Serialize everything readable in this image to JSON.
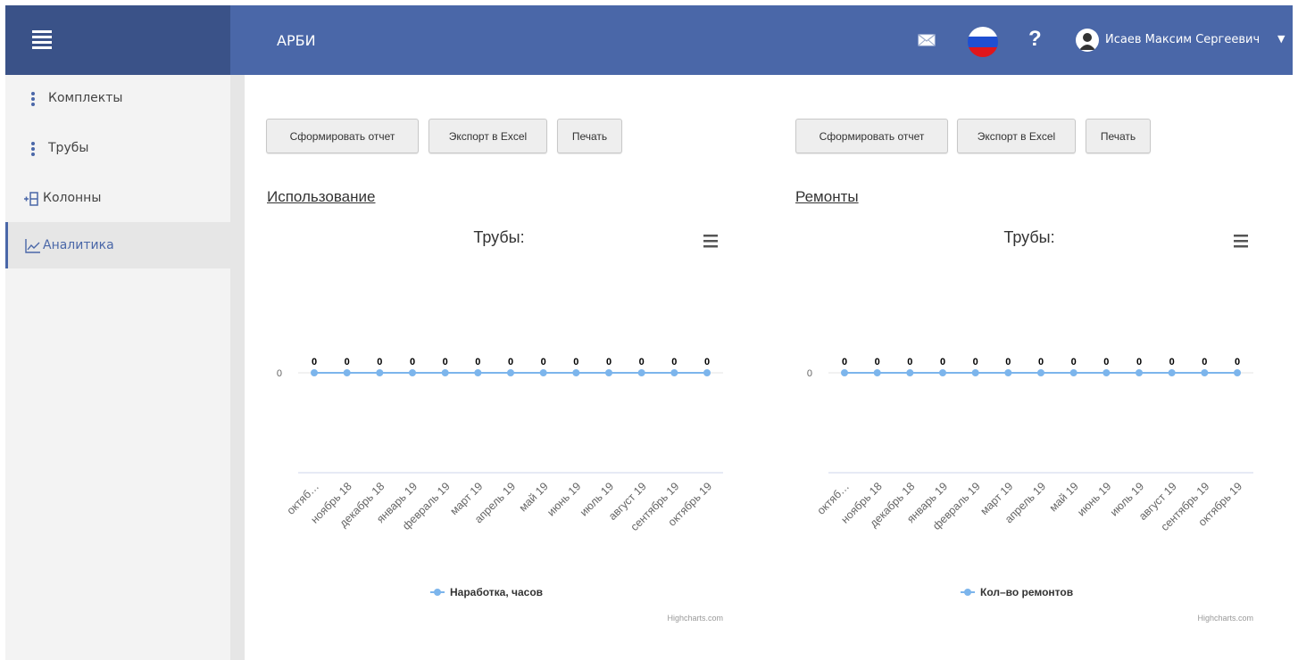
{
  "header": {
    "app_title": "АРБИ",
    "user_name": "Исаев Максим Сергеевич",
    "help_label": "?"
  },
  "sidebar": {
    "items": [
      {
        "label": "Комплекты",
        "icon": "vertical-dots-icon"
      },
      {
        "label": "Трубы",
        "icon": "vertical-dots-icon"
      },
      {
        "label": "Колонны",
        "icon": "column-add-icon"
      },
      {
        "label": "Аналитика",
        "icon": "line-chart-icon",
        "active": true
      }
    ]
  },
  "colors": {
    "brand": "#3a5288",
    "nav": "#4a67a8",
    "series": "#7cb5ec"
  },
  "panels": [
    {
      "buttons": {
        "report": "Сформировать отчет",
        "export": "Экспорт в Excel",
        "print": "Печать"
      },
      "section_title": "Использование",
      "credits": "Highcharts.com",
      "chart_data": {
        "type": "line",
        "title": "Трубы:",
        "categories": [
          "октяб…",
          "ноябрь 18",
          "декабрь 18",
          "январь 19",
          "февраль 19",
          "март 19",
          "апрель 19",
          "май 19",
          "июнь 19",
          "июль 19",
          "август 19",
          "сентябрь 19",
          "октябрь 19"
        ],
        "series": [
          {
            "name": "Наработка, часов",
            "values": [
              0,
              0,
              0,
              0,
              0,
              0,
              0,
              0,
              0,
              0,
              0,
              0,
              0
            ]
          }
        ],
        "y_ticks": [
          "0"
        ],
        "legend": "bottom-center"
      }
    },
    {
      "buttons": {
        "report": "Сформировать отчет",
        "export": "Экспорт в Excel",
        "print": "Печать"
      },
      "section_title": "Ремонты",
      "credits": "Highcharts.com",
      "chart_data": {
        "type": "line",
        "title": "Трубы:",
        "categories": [
          "октяб…",
          "ноябрь 18",
          "декабрь 18",
          "январь 19",
          "февраль 19",
          "март 19",
          "апрель 19",
          "май 19",
          "июнь 19",
          "июль 19",
          "август 19",
          "сентябрь 19",
          "октябрь 19"
        ],
        "series": [
          {
            "name": "Кол–во ремонтов",
            "values": [
              0,
              0,
              0,
              0,
              0,
              0,
              0,
              0,
              0,
              0,
              0,
              0,
              0
            ]
          }
        ],
        "y_ticks": [
          "0"
        ],
        "legend": "bottom-center"
      }
    }
  ]
}
